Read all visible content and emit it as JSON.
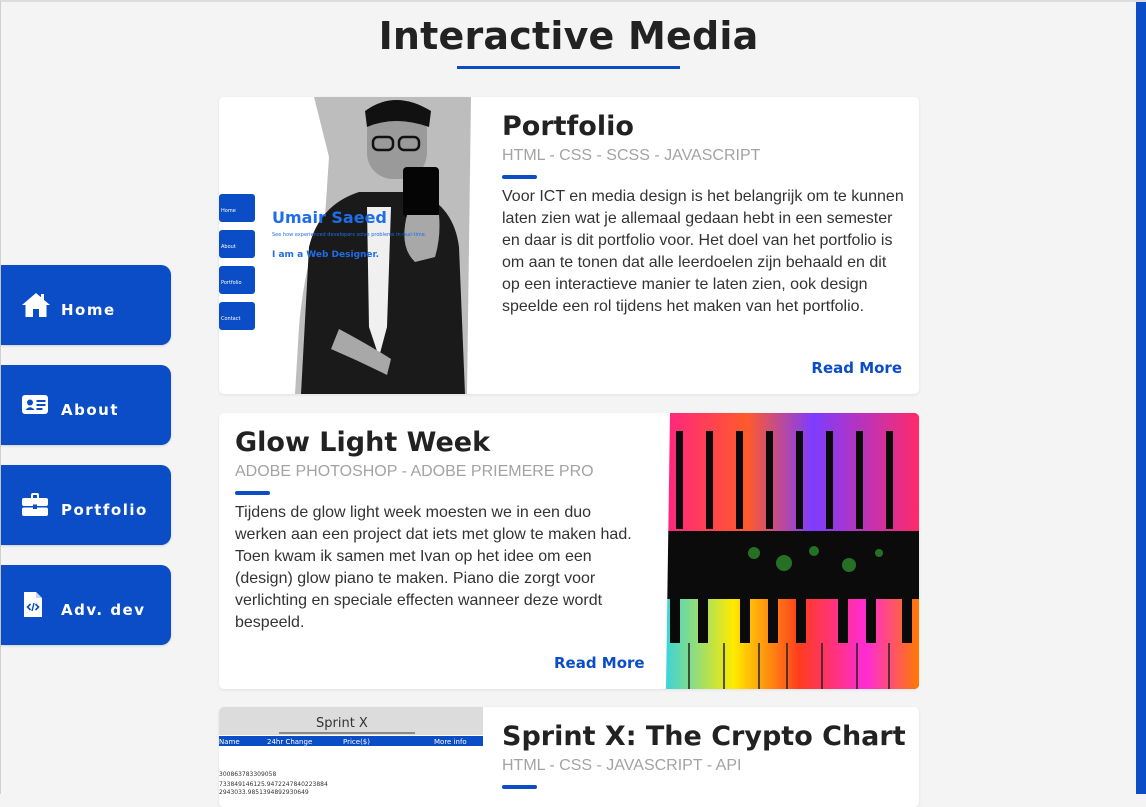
{
  "page": {
    "title": "Interactive Media"
  },
  "sidebar": {
    "items": [
      {
        "label": "Home",
        "icon": "home-icon"
      },
      {
        "label": "About",
        "icon": "id-card-icon"
      },
      {
        "label": "Portfolio",
        "icon": "briefcase-icon"
      },
      {
        "label": "Adv. dev",
        "icon": "code-file-icon"
      }
    ]
  },
  "colors": {
    "accent": "#0b4dc6",
    "background": "#f4f4f4",
    "card": "#ffffff",
    "tag_text": "#a3a3a3"
  },
  "projects": [
    {
      "title": "Portfolio",
      "tags": "HTML - CSS - SCSS - JAVASCRIPT",
      "description": "Voor ICT en media design is het belangrijk om te kunnen laten zien wat je allemaal gedaan hebt in een semester en daar is dit portfolio voor. Het doel van het portfolio is om aan te tonen dat alle leerdoelen zijn behaald en dit op een interactieve manier te laten zien, ook design speelde een rol tijdens het maken van het portfolio.",
      "read_more": "Read More",
      "image": {
        "name_text": "Umair Saeed",
        "sub_text": "See how experienced developers solve problems in real-time.",
        "role_text": "I am a Web Designer.",
        "nav": [
          "Home",
          "About",
          "Portfolio",
          "Contact"
        ]
      }
    },
    {
      "title": "Glow Light Week",
      "tags": "ADOBE PHOTOSHOP - ADOBE PRIEMERE PRO",
      "description": "Tijdens de glow light week moesten we in een duo werken aan een project dat iets met glow te maken had. Toen kwam ik samen met Ivan op het idee om een (design) glow piano te maken. Piano die zorgt voor verlichting en speciale effecten wanneer deze wordt bespeeld.",
      "read_more": "Read More"
    },
    {
      "title": "Sprint X: The Crypto Chart",
      "tags": "HTML - CSS - JAVASCRIPT - API",
      "image": {
        "heading": "Sprint X",
        "columns": [
          "Name",
          "24hr Change",
          "Price($)",
          "More info"
        ],
        "rows": [
          "300863783309058",
          "733849146125.9472247840223884",
          "2943033.9851394892930649"
        ]
      }
    }
  ]
}
